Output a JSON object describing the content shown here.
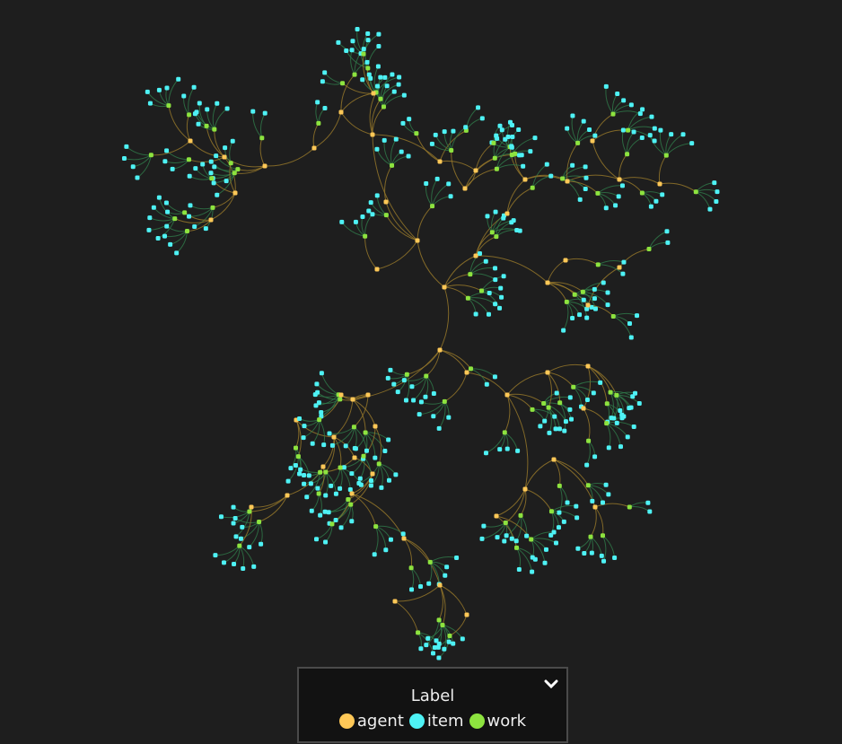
{
  "legend": {
    "title": "Label",
    "items": [
      {
        "label": "agent",
        "color": "#ffc857"
      },
      {
        "label": "item",
        "color": "#4ef2f5"
      },
      {
        "label": "work",
        "color": "#8de33f"
      }
    ],
    "toggle_icon": "chevron-down-icon"
  },
  "colors": {
    "background": "#1e1e1e",
    "agent_edge": "#9a7a2a",
    "work_edge": "#2f7a4a"
  }
}
